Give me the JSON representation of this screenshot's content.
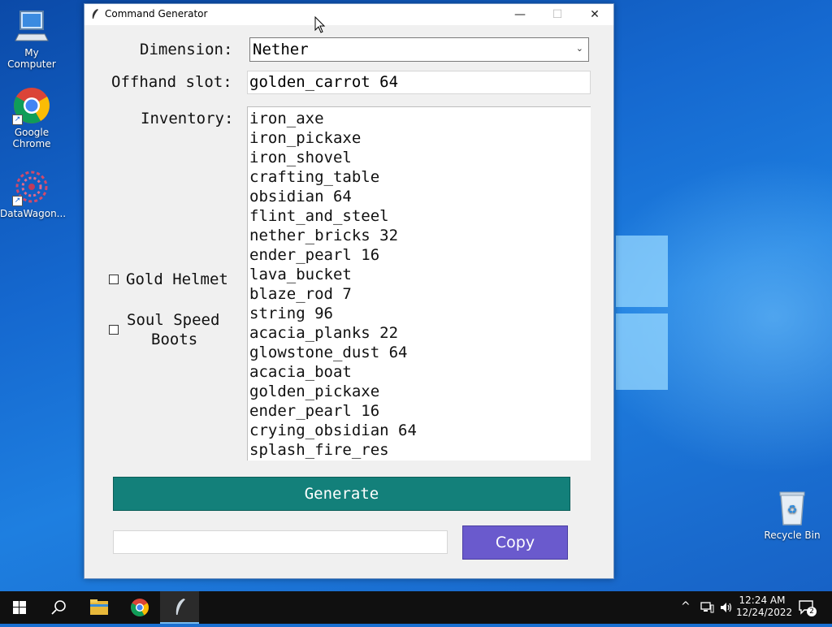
{
  "desktop": {
    "icons": [
      {
        "label": "My Computer"
      },
      {
        "label": "Google Chrome"
      },
      {
        "label": "DataWagon..."
      },
      {
        "label": "Recycle Bin"
      }
    ]
  },
  "window": {
    "title": "Command Generator",
    "controls": {
      "minimize": "—",
      "maximize": "☐",
      "close": "✕"
    },
    "dimension": {
      "label": "Dimension:",
      "value": "Nether"
    },
    "offhand": {
      "label": "Offhand slot:",
      "value": "golden_carrot 64"
    },
    "inventory": {
      "label": "Inventory:",
      "items": [
        "iron_axe",
        "iron_pickaxe",
        "iron_shovel",
        "crafting_table",
        "obsidian 64",
        "flint_and_steel",
        "nether_bricks 32",
        "ender_pearl 16",
        "lava_bucket",
        "blaze_rod 7",
        "string 96",
        "acacia_planks 22",
        "glowstone_dust 64",
        "acacia_boat",
        "golden_pickaxe",
        "ender_pearl 16",
        "crying_obsidian 64",
        "splash_fire_res"
      ]
    },
    "gold_helmet": {
      "label": "Gold Helmet",
      "checked": false
    },
    "soul_speed": {
      "label_line1": "Soul Speed",
      "label_line2": "Boots",
      "checked": false
    },
    "generate_label": "Generate",
    "output_value": "",
    "copy_label": "Copy",
    "colors": {
      "generate": "#13807a",
      "copy": "#6a5acd"
    }
  },
  "taskbar": {
    "time": "12:24 AM",
    "date": "12/24/2022",
    "notification_count": "2"
  }
}
